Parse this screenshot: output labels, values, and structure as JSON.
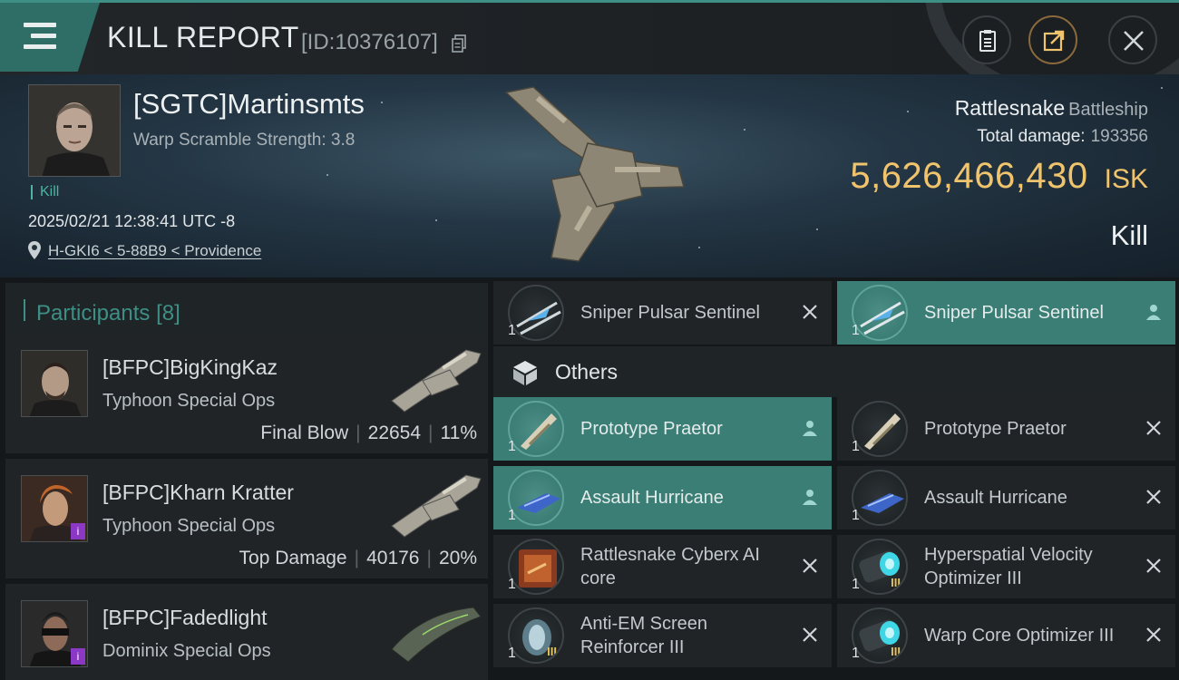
{
  "header": {
    "title": "KILL REPORT",
    "report_id": "[ID:10376107]"
  },
  "victim": {
    "name": "[SGTC]Martinsmts",
    "warp_scramble": "Warp Scramble Strength: 3.8",
    "kill_tag": "Kill",
    "datetime": "2025/02/21 12:38:41 UTC -8",
    "location": "H-GKI6 < 5-88B9 < Providence",
    "ship_name": "Rattlesnake",
    "ship_class": "Battleship",
    "total_damage_label": "Total damage:",
    "total_damage": "193356",
    "isk_value": "5,626,466,430",
    "isk_unit": "ISK",
    "result": "Kill"
  },
  "participants": {
    "title": "Participants",
    "count": "[8]",
    "rows": [
      {
        "name": "[BFPC]BigKingKaz",
        "ship": "Typhoon Special Ops",
        "tag": "Final Blow",
        "damage": "22654",
        "pct": "11%",
        "badge": ""
      },
      {
        "name": "[BFPC]Kharn Kratter",
        "ship": "Typhoon Special Ops",
        "tag": "Top Damage",
        "damage": "40176",
        "pct": "20%",
        "badge": "i"
      },
      {
        "name": "[BFPC]Fadedlight",
        "ship": "Dominix Special Ops",
        "tag": "",
        "damage": "",
        "pct": "",
        "badge": "i"
      }
    ]
  },
  "items": {
    "top_row": [
      {
        "name": "Sniper Pulsar Sentinel",
        "qty": "1",
        "state": "destroyed"
      },
      {
        "name": "Sniper Pulsar Sentinel",
        "qty": "1",
        "state": "dropped"
      }
    ],
    "others_title": "Others",
    "others": [
      {
        "name": "Prototype  Praetor",
        "qty": "1",
        "state": "dropped"
      },
      {
        "name": "Prototype  Praetor",
        "qty": "1",
        "state": "destroyed"
      },
      {
        "name": "Assault Hurricane",
        "qty": "1",
        "state": "dropped"
      },
      {
        "name": "Assault Hurricane",
        "qty": "1",
        "state": "destroyed"
      },
      {
        "name": "Rattlesnake Cyberx AI core",
        "qty": "1",
        "state": "destroyed"
      },
      {
        "name": "Hyperspatial Velocity Optimizer III",
        "qty": "1",
        "state": "destroyed"
      },
      {
        "name": "Anti-EM Screen Reinforcer III",
        "qty": "1",
        "state": "destroyed"
      },
      {
        "name": "Warp Core Optimizer III",
        "qty": "1",
        "state": "destroyed"
      }
    ]
  },
  "colors": {
    "accent": "#3e8f86",
    "isk_gold": "#f0c36d",
    "highlight_row": "#3b7e76",
    "purple_badge": "#8b38c4"
  },
  "icons": [
    "menu-icon",
    "copy-icon",
    "clipboard-icon",
    "share-icon",
    "close-icon",
    "location-pin-icon",
    "cube-icon",
    "pilot-icon",
    "x-icon"
  ]
}
